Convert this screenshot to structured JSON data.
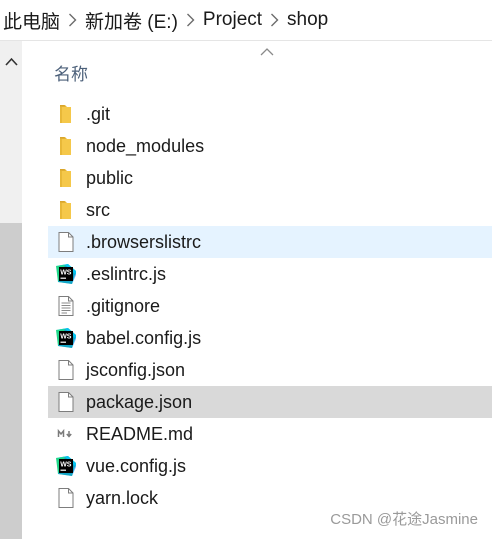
{
  "breadcrumb": {
    "items": [
      "此电脑",
      "新加卷 (E:)",
      "Project",
      "shop"
    ]
  },
  "header": {
    "name_label": "名称"
  },
  "files": [
    {
      "name": ".git",
      "type": "folder",
      "icon": "folder-icon",
      "state": "normal"
    },
    {
      "name": "node_modules",
      "type": "folder",
      "icon": "folder-icon",
      "state": "normal"
    },
    {
      "name": "public",
      "type": "folder",
      "icon": "folder-icon",
      "state": "normal"
    },
    {
      "name": "src",
      "type": "folder",
      "icon": "folder-icon",
      "state": "normal"
    },
    {
      "name": ".browserslistrc",
      "type": "file",
      "icon": "blank-file-icon",
      "state": "hover"
    },
    {
      "name": ".eslintrc.js",
      "type": "webstorm",
      "icon": "webstorm-file-icon",
      "state": "normal"
    },
    {
      "name": ".gitignore",
      "type": "text",
      "icon": "text-file-icon",
      "state": "normal"
    },
    {
      "name": "babel.config.js",
      "type": "webstorm",
      "icon": "webstorm-file-icon",
      "state": "normal"
    },
    {
      "name": "jsconfig.json",
      "type": "file",
      "icon": "blank-file-icon",
      "state": "normal"
    },
    {
      "name": "package.json",
      "type": "file",
      "icon": "blank-file-icon",
      "state": "selected"
    },
    {
      "name": "README.md",
      "type": "markdown",
      "icon": "markdown-file-icon",
      "state": "normal"
    },
    {
      "name": "vue.config.js",
      "type": "webstorm",
      "icon": "webstorm-file-icon",
      "state": "normal"
    },
    {
      "name": "yarn.lock",
      "type": "file",
      "icon": "blank-file-icon",
      "state": "normal"
    }
  ],
  "colors": {
    "folder": "#f5c84a",
    "hover": "#e5f3ff",
    "selected": "#d9d9d9",
    "header_text": "#4c607a"
  },
  "watermark": "CSDN @花途Jasmine"
}
